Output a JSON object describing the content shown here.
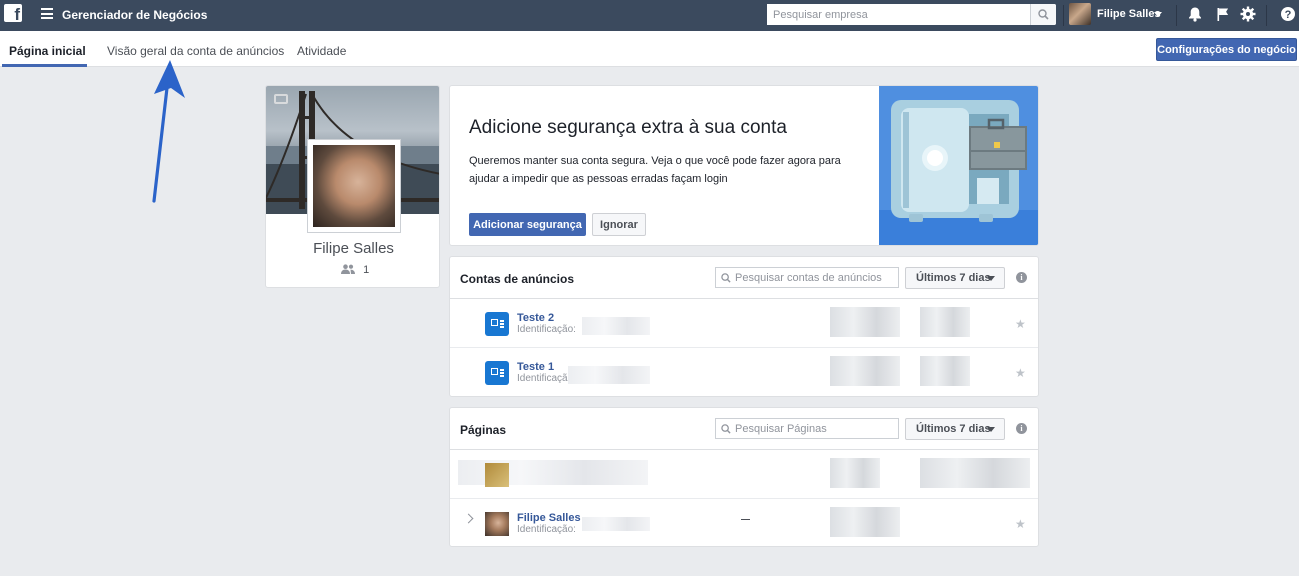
{
  "topbar": {
    "logo_letter": "f",
    "app_title": "Gerenciador de Negócios",
    "search_placeholder": "Pesquisar empresa",
    "user_name": "Filipe Salles",
    "icons": [
      "facebook-logo",
      "menu-icon",
      "search-icon",
      "bell-icon",
      "flag-icon",
      "gear-icon",
      "help-icon"
    ]
  },
  "tabs": {
    "items": [
      {
        "label": "Página inicial",
        "active": true
      },
      {
        "label": "Visão geral da conta de anúncios",
        "active": false
      },
      {
        "label": "Atividade",
        "active": false
      }
    ],
    "settings_button": "Configurações do negócio"
  },
  "profile": {
    "name": "Filipe Salles",
    "people_count": "1"
  },
  "security": {
    "title": "Adicione segurança extra à sua conta",
    "description": "Queremos manter sua conta segura. Veja o que você pode fazer agora para ajudar a impedir que as pessoas erradas façam login",
    "primary_button": "Adicionar segurança",
    "secondary_button": "Ignorar"
  },
  "ad_accounts": {
    "title": "Contas de anúncios",
    "search_placeholder": "Pesquisar contas de anúncios",
    "range_label": "Últimos 7 dias",
    "rows": [
      {
        "name": "Teste 2",
        "id_label": "Identificação:"
      },
      {
        "name": "Teste 1",
        "id_label": "Identificaçã"
      }
    ]
  },
  "pages": {
    "title": "Páginas",
    "search_placeholder": "Pesquisar Páginas",
    "range_label": "Últimos 7 dias",
    "rows": [
      {
        "name": "",
        "id_label": ""
      },
      {
        "name": "Filipe Salles",
        "id_label": "Identificação:",
        "metric": "—"
      }
    ]
  },
  "colors": {
    "topbar": "#3b4a5e",
    "accent": "#4267b2",
    "page_bg": "#e9ebee",
    "ad_icon": "#1877d2",
    "arrow": "#2b63c9"
  }
}
